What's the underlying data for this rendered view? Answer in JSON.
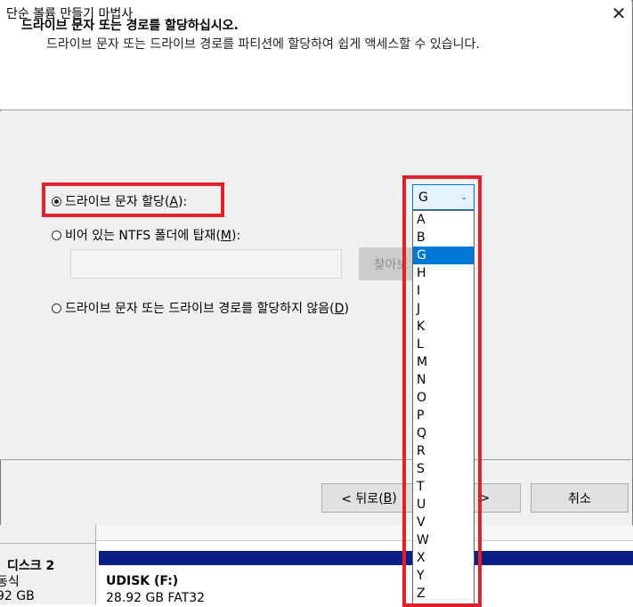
{
  "window": {
    "title": "단순 볼륨 만들기 마법사",
    "close_glyph": "✕",
    "header_title": "드라이브 문자 또는 경로를 할당하십시오.",
    "header_subtitle": "드라이브 문자 또는 드라이브 경로를 파티션에 할당하여 쉽게 액세스할 수 있습니다."
  },
  "options": {
    "assign_letter": {
      "label": "드라이브 문자 할당(",
      "accel": "A",
      "suffix": "):",
      "checked": true
    },
    "mount_folder": {
      "label": "비어 있는 NTFS 폴더에 탑재(",
      "accel": "M",
      "suffix": "):",
      "checked": false
    },
    "no_assign": {
      "label": "드라이브 문자 또는 드라이브 경로를 할당하지 않음(",
      "accel": "D",
      "suffix": ")",
      "checked": false
    }
  },
  "mount_path_value": "",
  "browse_label": "찾아보",
  "drive_combo": {
    "selected": "G",
    "chevron": "⌄",
    "options": [
      "A",
      "B",
      "G",
      "H",
      "I",
      "J",
      "K",
      "L",
      "M",
      "N",
      "O",
      "P",
      "Q",
      "R",
      "S",
      "T",
      "U",
      "V",
      "W",
      "X",
      "Y",
      "Z"
    ]
  },
  "buttons": {
    "back": {
      "label": "< 뒤로(",
      "accel": "B",
      "suffix": ")"
    },
    "next": {
      "label": "(N) >"
    },
    "cancel": "취소"
  },
  "background": {
    "disk_name": "디스크 2",
    "disk_type": "동식",
    "disk_size": "92 GB",
    "volume_name": "UDISK  (F:)",
    "volume_info": "28.92 GB FAT32"
  },
  "colors": {
    "selection": "#0078d7",
    "highlight": "#e0202a",
    "volume_bar": "#0a1e84"
  }
}
